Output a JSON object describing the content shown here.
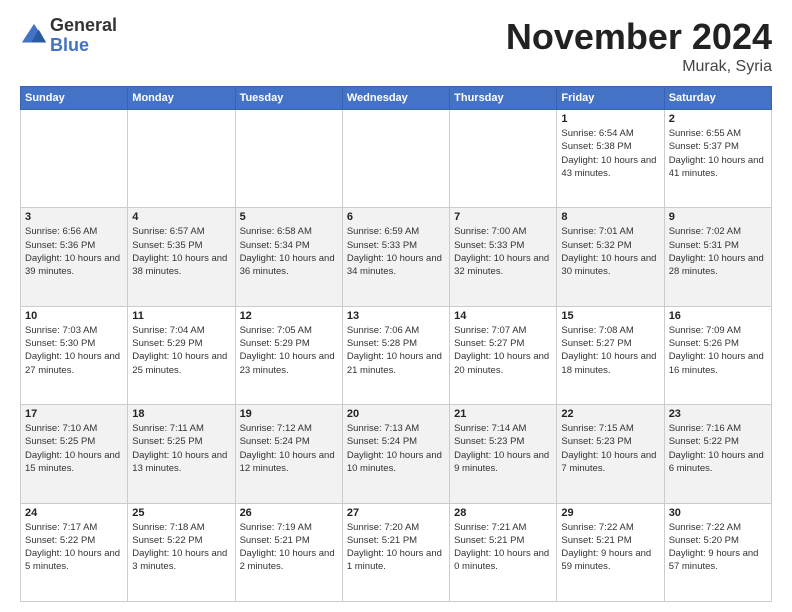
{
  "header": {
    "logo_general": "General",
    "logo_blue": "Blue",
    "month": "November 2024",
    "location": "Murak, Syria"
  },
  "days_of_week": [
    "Sunday",
    "Monday",
    "Tuesday",
    "Wednesday",
    "Thursday",
    "Friday",
    "Saturday"
  ],
  "weeks": [
    [
      {
        "num": "",
        "info": ""
      },
      {
        "num": "",
        "info": ""
      },
      {
        "num": "",
        "info": ""
      },
      {
        "num": "",
        "info": ""
      },
      {
        "num": "",
        "info": ""
      },
      {
        "num": "1",
        "info": "Sunrise: 6:54 AM\nSunset: 5:38 PM\nDaylight: 10 hours and 43 minutes."
      },
      {
        "num": "2",
        "info": "Sunrise: 6:55 AM\nSunset: 5:37 PM\nDaylight: 10 hours and 41 minutes."
      }
    ],
    [
      {
        "num": "3",
        "info": "Sunrise: 6:56 AM\nSunset: 5:36 PM\nDaylight: 10 hours and 39 minutes."
      },
      {
        "num": "4",
        "info": "Sunrise: 6:57 AM\nSunset: 5:35 PM\nDaylight: 10 hours and 38 minutes."
      },
      {
        "num": "5",
        "info": "Sunrise: 6:58 AM\nSunset: 5:34 PM\nDaylight: 10 hours and 36 minutes."
      },
      {
        "num": "6",
        "info": "Sunrise: 6:59 AM\nSunset: 5:33 PM\nDaylight: 10 hours and 34 minutes."
      },
      {
        "num": "7",
        "info": "Sunrise: 7:00 AM\nSunset: 5:33 PM\nDaylight: 10 hours and 32 minutes."
      },
      {
        "num": "8",
        "info": "Sunrise: 7:01 AM\nSunset: 5:32 PM\nDaylight: 10 hours and 30 minutes."
      },
      {
        "num": "9",
        "info": "Sunrise: 7:02 AM\nSunset: 5:31 PM\nDaylight: 10 hours and 28 minutes."
      }
    ],
    [
      {
        "num": "10",
        "info": "Sunrise: 7:03 AM\nSunset: 5:30 PM\nDaylight: 10 hours and 27 minutes."
      },
      {
        "num": "11",
        "info": "Sunrise: 7:04 AM\nSunset: 5:29 PM\nDaylight: 10 hours and 25 minutes."
      },
      {
        "num": "12",
        "info": "Sunrise: 7:05 AM\nSunset: 5:29 PM\nDaylight: 10 hours and 23 minutes."
      },
      {
        "num": "13",
        "info": "Sunrise: 7:06 AM\nSunset: 5:28 PM\nDaylight: 10 hours and 21 minutes."
      },
      {
        "num": "14",
        "info": "Sunrise: 7:07 AM\nSunset: 5:27 PM\nDaylight: 10 hours and 20 minutes."
      },
      {
        "num": "15",
        "info": "Sunrise: 7:08 AM\nSunset: 5:27 PM\nDaylight: 10 hours and 18 minutes."
      },
      {
        "num": "16",
        "info": "Sunrise: 7:09 AM\nSunset: 5:26 PM\nDaylight: 10 hours and 16 minutes."
      }
    ],
    [
      {
        "num": "17",
        "info": "Sunrise: 7:10 AM\nSunset: 5:25 PM\nDaylight: 10 hours and 15 minutes."
      },
      {
        "num": "18",
        "info": "Sunrise: 7:11 AM\nSunset: 5:25 PM\nDaylight: 10 hours and 13 minutes."
      },
      {
        "num": "19",
        "info": "Sunrise: 7:12 AM\nSunset: 5:24 PM\nDaylight: 10 hours and 12 minutes."
      },
      {
        "num": "20",
        "info": "Sunrise: 7:13 AM\nSunset: 5:24 PM\nDaylight: 10 hours and 10 minutes."
      },
      {
        "num": "21",
        "info": "Sunrise: 7:14 AM\nSunset: 5:23 PM\nDaylight: 10 hours and 9 minutes."
      },
      {
        "num": "22",
        "info": "Sunrise: 7:15 AM\nSunset: 5:23 PM\nDaylight: 10 hours and 7 minutes."
      },
      {
        "num": "23",
        "info": "Sunrise: 7:16 AM\nSunset: 5:22 PM\nDaylight: 10 hours and 6 minutes."
      }
    ],
    [
      {
        "num": "24",
        "info": "Sunrise: 7:17 AM\nSunset: 5:22 PM\nDaylight: 10 hours and 5 minutes."
      },
      {
        "num": "25",
        "info": "Sunrise: 7:18 AM\nSunset: 5:22 PM\nDaylight: 10 hours and 3 minutes."
      },
      {
        "num": "26",
        "info": "Sunrise: 7:19 AM\nSunset: 5:21 PM\nDaylight: 10 hours and 2 minutes."
      },
      {
        "num": "27",
        "info": "Sunrise: 7:20 AM\nSunset: 5:21 PM\nDaylight: 10 hours and 1 minute."
      },
      {
        "num": "28",
        "info": "Sunrise: 7:21 AM\nSunset: 5:21 PM\nDaylight: 10 hours and 0 minutes."
      },
      {
        "num": "29",
        "info": "Sunrise: 7:22 AM\nSunset: 5:21 PM\nDaylight: 9 hours and 59 minutes."
      },
      {
        "num": "30",
        "info": "Sunrise: 7:22 AM\nSunset: 5:20 PM\nDaylight: 9 hours and 57 minutes."
      }
    ]
  ]
}
